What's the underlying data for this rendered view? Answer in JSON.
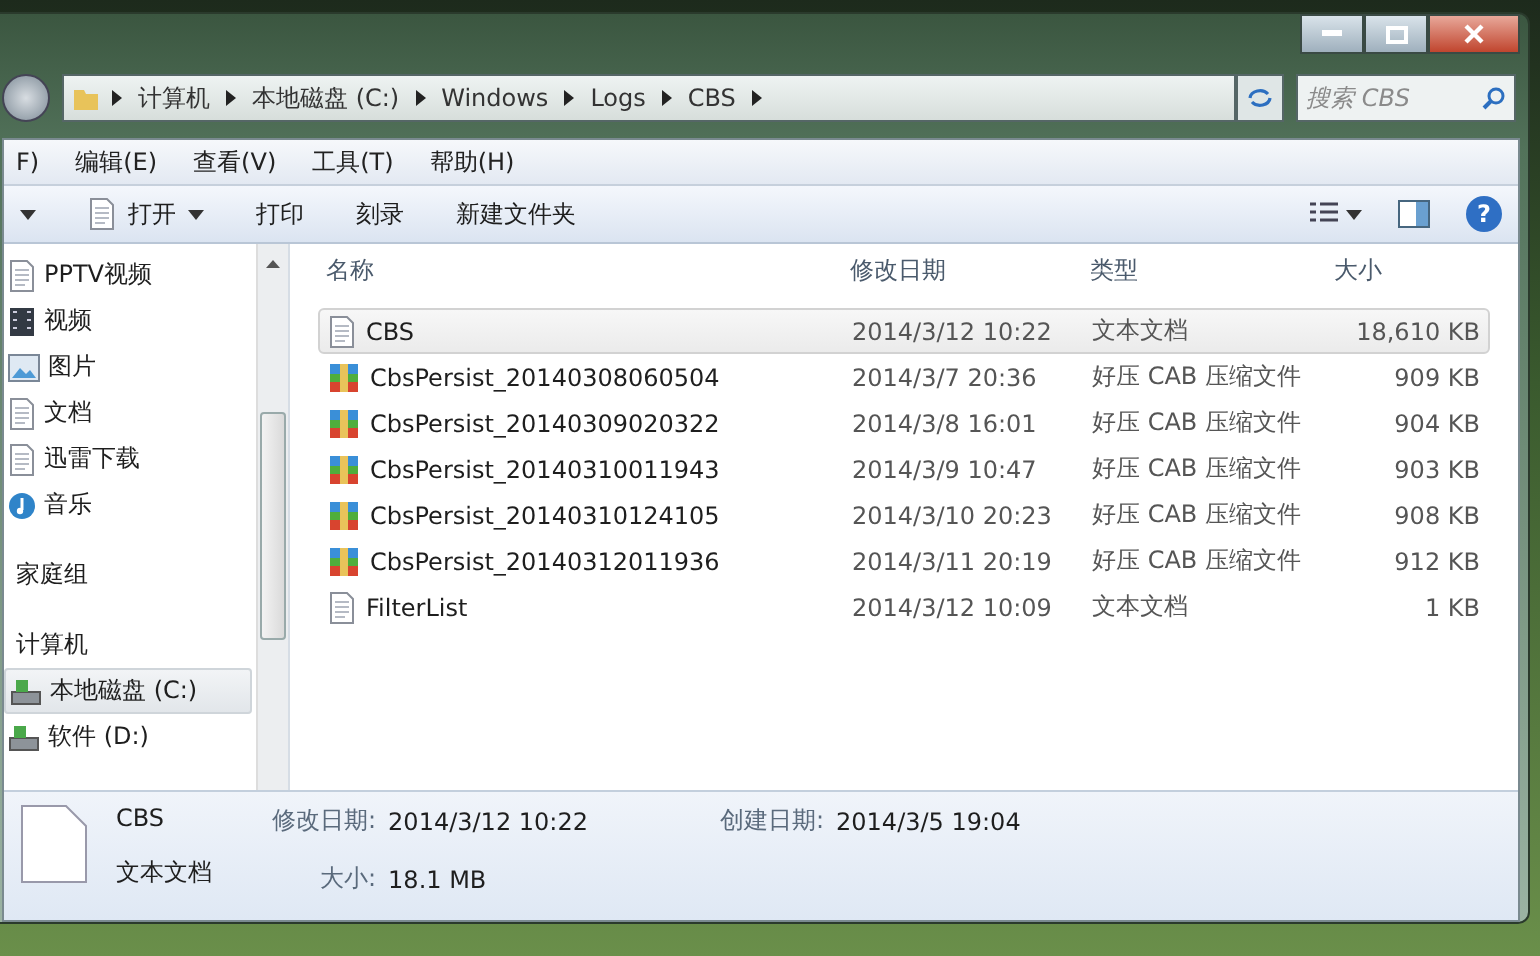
{
  "address_bar": {
    "crumbs": [
      "计算机",
      "本地磁盘 (C:)",
      "Windows",
      "Logs",
      "CBS"
    ]
  },
  "search": {
    "placeholder": "搜索 CBS"
  },
  "help_button": "?",
  "menu_bar": [
    "F)",
    "编辑(E)",
    "查看(V)",
    "工具(T)",
    "帮助(H)"
  ],
  "toolbar": [
    "打开",
    "打印",
    "刻录",
    "新建文件夹"
  ],
  "sidebar": {
    "items": [
      {
        "label": "PPTV视频",
        "kind": "doc",
        "selected": false
      },
      {
        "label": "视频",
        "kind": "film",
        "selected": false
      },
      {
        "label": "图片",
        "kind": "picture",
        "selected": false
      },
      {
        "label": "文档",
        "kind": "doc",
        "selected": false
      },
      {
        "label": "迅雷下载",
        "kind": "doc",
        "selected": false
      },
      {
        "label": "音乐",
        "kind": "music",
        "selected": false
      },
      {
        "label": "家庭组",
        "kind": "group",
        "selected": false
      },
      {
        "label": "计算机",
        "kind": "group",
        "selected": false
      },
      {
        "label": "本地磁盘 (C:)",
        "kind": "drive",
        "selected": true
      },
      {
        "label": "软件 (D:)",
        "kind": "drive",
        "selected": false
      }
    ]
  },
  "table": {
    "columns": [
      "名称",
      "修改日期",
      "类型",
      "大小"
    ],
    "rows": [
      {
        "name": "CBS",
        "date": "2014/3/12 10:22",
        "type": "文本文档",
        "size": "18,610 KB",
        "kind": "text",
        "selected": true
      },
      {
        "name": "CbsPersist_20140308060504",
        "date": "2014/3/7 20:36",
        "type": "好压 CAB 压缩文件",
        "size": "909 KB",
        "kind": "archive",
        "selected": false
      },
      {
        "name": "CbsPersist_20140309020322",
        "date": "2014/3/8 16:01",
        "type": "好压 CAB 压缩文件",
        "size": "904 KB",
        "kind": "archive",
        "selected": false
      },
      {
        "name": "CbsPersist_20140310011943",
        "date": "2014/3/9 10:47",
        "type": "好压 CAB 压缩文件",
        "size": "903 KB",
        "kind": "archive",
        "selected": false
      },
      {
        "name": "CbsPersist_20140310124105",
        "date": "2014/3/10 20:23",
        "type": "好压 CAB 压缩文件",
        "size": "908 KB",
        "kind": "archive",
        "selected": false
      },
      {
        "name": "CbsPersist_20140312011936",
        "date": "2014/3/11 20:19",
        "type": "好压 CAB 压缩文件",
        "size": "912 KB",
        "kind": "archive",
        "selected": false
      },
      {
        "name": "FilterList",
        "date": "2014/3/12 10:09",
        "type": "文本文档",
        "size": "1 KB",
        "kind": "text",
        "selected": false
      }
    ]
  },
  "details": {
    "name": "CBS",
    "type": "文本文档",
    "fields": [
      {
        "label": "修改日期:",
        "value": "2014/3/12 10:22"
      },
      {
        "label": "大小:",
        "value": "18.1 MB"
      },
      {
        "label": "创建日期:",
        "value": "2014/3/5 19:04"
      }
    ]
  }
}
